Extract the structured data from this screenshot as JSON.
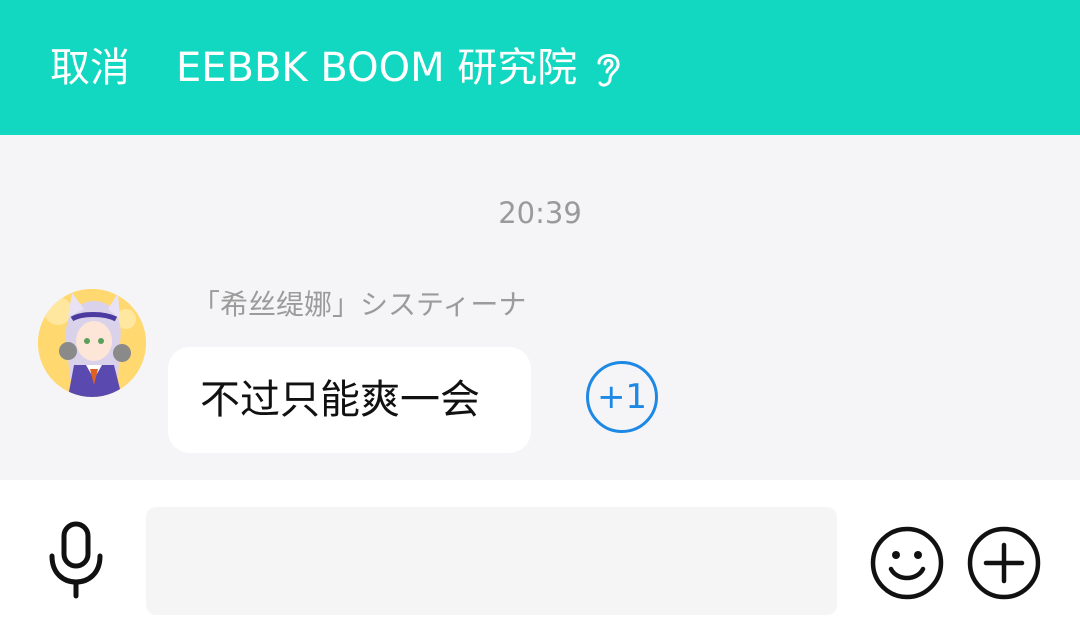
{
  "header": {
    "cancel_label": "取消",
    "title": "EEBBK BOOM 研究院",
    "title_icon": "ear-icon"
  },
  "chat": {
    "timestamp": "20:39",
    "message": {
      "sender": "「希丝缇娜」システィーナ",
      "text": "不过只能爽一会",
      "avatar": "anime-character-avatar",
      "plus_one_label": "+1"
    }
  },
  "input_bar": {
    "mic_icon": "microphone-icon",
    "input_value": "",
    "emoji_icon": "smiley-icon",
    "add_icon": "plus-circle-icon"
  },
  "colors": {
    "header_bg": "#13d8c1",
    "plus_one": "#1e88e5",
    "chat_bg": "#f5f5f7"
  }
}
